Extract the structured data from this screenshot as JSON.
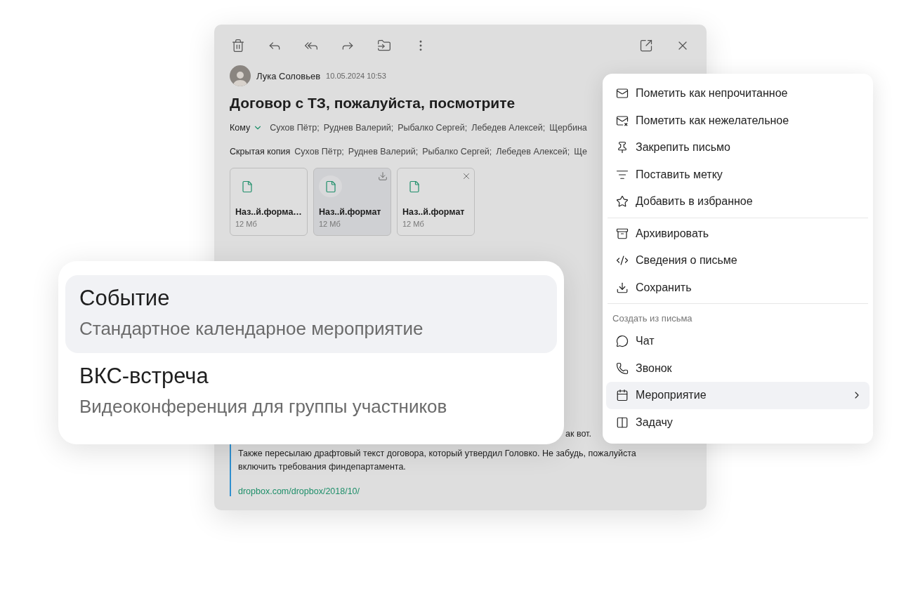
{
  "email": {
    "sender": "Лука Соловьев",
    "date": "10.05.2024 10:53",
    "subject": "Договор с ТЗ, пожалуйста, посмотрите",
    "to": {
      "label": "Кому",
      "expanded": false,
      "recipients": [
        "Сухов Пётр;",
        "Руднев Валерий;",
        "Рыбалко Сергей;",
        "Лебедев Алексей;",
        "Щербина"
      ]
    },
    "bcc": {
      "label": "Скрытая копия",
      "recipients": [
        "Сухов Пётр;",
        "Руднев Валерий;",
        "Рыбалко Сергей;",
        "Лебедев Алексей;",
        "Ще"
      ]
    },
    "attachments": [
      {
        "name": "Наз..й.форма…",
        "size": "12 Мб",
        "selected": false,
        "kind": "plain"
      },
      {
        "name": "Наз..й.формат",
        "size": "12 Мб",
        "selected": true,
        "kind": "download"
      },
      {
        "name": "Наз..й.формат",
        "size": "12 Мб",
        "selected": false,
        "kind": "remove"
      }
    ],
    "body_fragment": "ак вот.",
    "quote": {
      "text": "Также пересылаю драфтовый текст договора, который утвердил Головко. Не забудь, пожалуйста включить требования финдепартамента.",
      "link": "dropbox.com/dropbox/2018/10/"
    }
  },
  "event_popup": {
    "options": [
      {
        "title": "Событие",
        "subtitle": "Стандартное календарное мероприятие",
        "selected": true
      },
      {
        "title": "ВКС-встреча",
        "subtitle": "Видеоконференция для группы участников",
        "selected": false
      }
    ]
  },
  "context_menu": {
    "sections": [
      {
        "items": [
          {
            "label": "Пометить как непрочитанное",
            "selected": false
          },
          {
            "label": "Пометить как нежелательное",
            "selected": false
          },
          {
            "label": "Закрепить письмо",
            "selected": false
          },
          {
            "label": "Поставить метку",
            "selected": false
          },
          {
            "label": "Добавить в избранное",
            "selected": false
          }
        ]
      },
      {
        "items": [
          {
            "label": "Архивировать",
            "selected": false
          },
          {
            "label": "Сведения о письме",
            "selected": false
          },
          {
            "label": "Сохранить",
            "selected": false
          }
        ]
      },
      {
        "header": "Создать из письма",
        "items": [
          {
            "label": "Чат",
            "selected": false
          },
          {
            "label": "Звонок",
            "selected": false
          },
          {
            "label": "Мероприятие",
            "selected": true,
            "submenu": true
          },
          {
            "label": "Задачу",
            "selected": false
          }
        ]
      }
    ]
  }
}
